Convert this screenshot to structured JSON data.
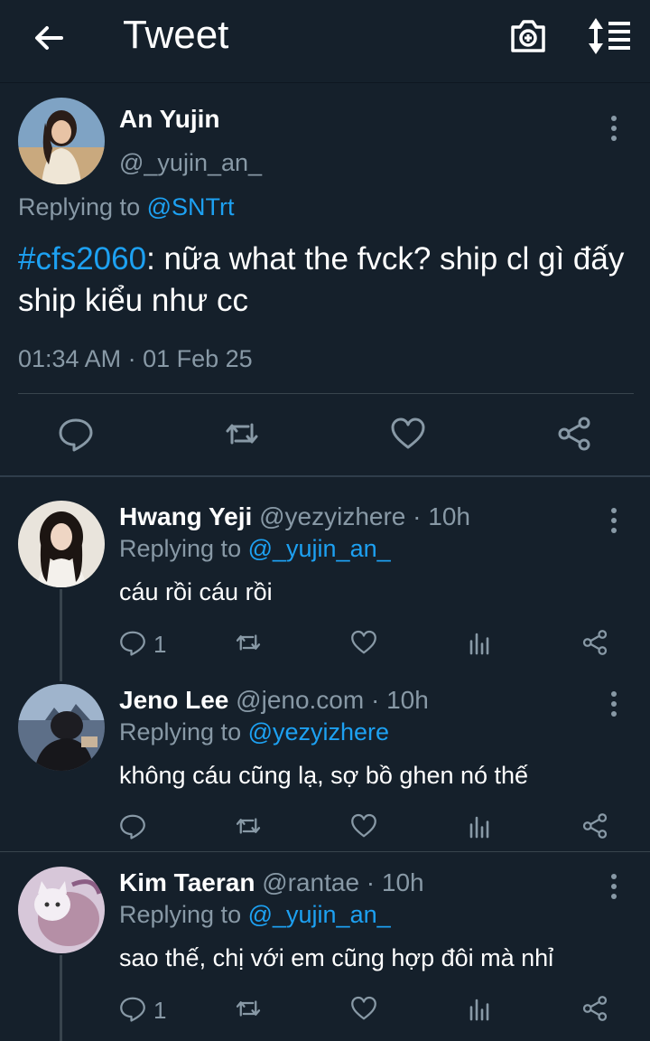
{
  "header": {
    "title": "Tweet",
    "back_icon": "arrow-left-icon",
    "camera_icon": "camera-plus-icon",
    "sort_icon": "sort-list-icon"
  },
  "tweet": {
    "author_name": "An Yujin",
    "author_handle": "@_yujin_an_",
    "replying_prefix": "Replying to ",
    "replying_to": "@SNTrt",
    "hashtag": "#cfs2060",
    "text": ": nữa what the fvck? ship cl gì đấy ship kiểu như cc",
    "timestamp": "01:34 AM · 01 Feb 25",
    "actions": [
      "reply-icon",
      "retweet-icon",
      "like-icon",
      "share-icon"
    ]
  },
  "replies": [
    {
      "author_name": "Hwang Yeji",
      "meta": " @yezyizhere · 10h",
      "replying_prefix": "Replying to ",
      "replying_to": "@_yujin_an_",
      "text": "cáu rồi cáu rồi",
      "reply_count": "1"
    },
    {
      "author_name": "Jeno Lee",
      "meta": " @jeno.com · 10h",
      "replying_prefix": "Replying to ",
      "replying_to": "@yezyizhere",
      "text": "không cáu cũng lạ, sợ bồ ghen nó thế",
      "reply_count": ""
    },
    {
      "author_name": "Kim Taeran",
      "meta": " @rantae · 10h",
      "replying_prefix": "Replying to ",
      "replying_to": "@_yujin_an_",
      "text": "sao thế, chị với em cũng hợp đôi mà nhỉ",
      "reply_count": "1"
    }
  ],
  "colors": {
    "background": "#15202b",
    "accent": "#1da1f2",
    "muted": "#8899a6",
    "divider": "#38444d"
  }
}
